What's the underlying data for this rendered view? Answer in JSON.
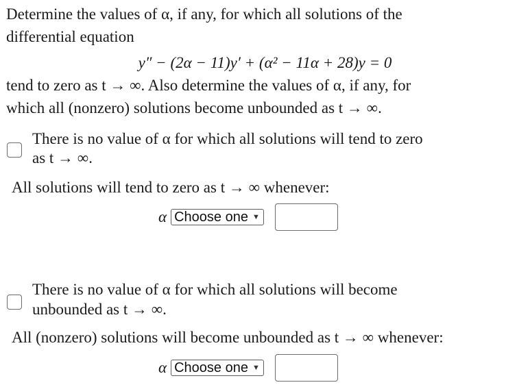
{
  "problem": {
    "intro_line1": "Determine the values of α, if any, for which all solutions of the",
    "intro_line2": "differential equation",
    "equation": "y″ − (2α − 11)y′ + (α² − 11α + 28)y = 0",
    "followup_line1": "tend to zero as t → ∞. Also determine the values of α, if any, for",
    "followup_line2": "which all (nonzero) solutions become unbounded as t → ∞."
  },
  "part_zero": {
    "checkbox_label_line1": "There is no value of α for which all solutions will tend to zero",
    "checkbox_label_line2": "as t → ∞.",
    "checked": false,
    "condition_text": "All solutions will tend to zero as t → ∞ whenever:",
    "variable": "α",
    "select_value": "Choose one",
    "select_arrow": "▼",
    "input_value": ""
  },
  "part_unbounded": {
    "checkbox_label_line1": "There is no value of α for which all solutions will become",
    "checkbox_label_line2": "unbounded as t → ∞.",
    "checked": false,
    "condition_text": "All (nonzero) solutions will become unbounded as t → ∞ whenever:",
    "variable": "α",
    "select_value": "Choose one",
    "select_arrow": "▼",
    "input_value": ""
  }
}
